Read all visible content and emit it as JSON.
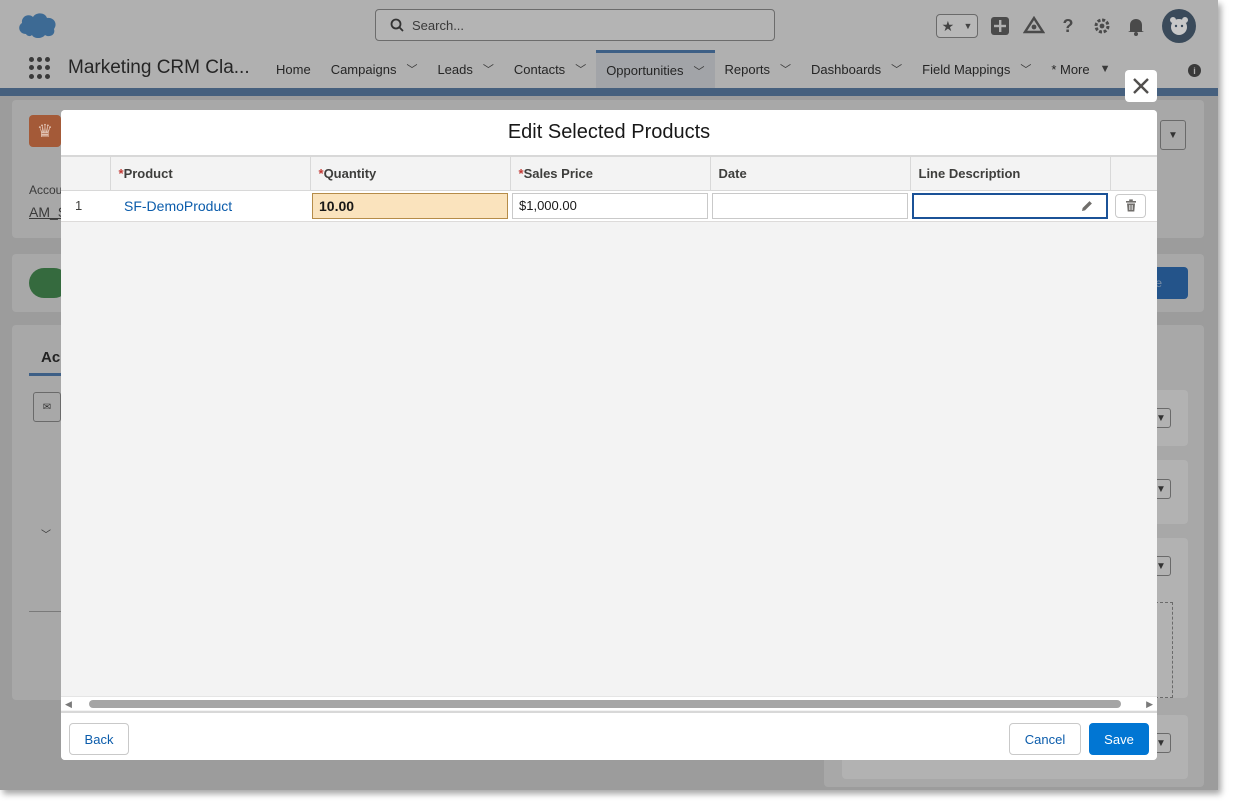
{
  "header": {
    "search_placeholder": "Search...",
    "icons": [
      "salesforce-cloud-logo",
      "search-icon",
      "star-icon",
      "add-icon",
      "trailhead-icon",
      "help-icon",
      "gear-icon",
      "bell-icon",
      "avatar"
    ]
  },
  "nav": {
    "app_name": "Marketing CRM Cla...",
    "items": [
      {
        "label": "Home",
        "has_menu": false
      },
      {
        "label": "Campaigns",
        "has_menu": true
      },
      {
        "label": "Leads",
        "has_menu": true
      },
      {
        "label": "Contacts",
        "has_menu": true
      },
      {
        "label": "Opportunities",
        "has_menu": true,
        "active": true
      },
      {
        "label": "Reports",
        "has_menu": true
      },
      {
        "label": "Dashboards",
        "has_menu": true
      },
      {
        "label": "Field Mappings",
        "has_menu": true
      },
      {
        "label": "* More",
        "has_menu": true
      }
    ]
  },
  "background": {
    "account_label": "Accou",
    "account_value": "AM_S",
    "tab_label": "Ac",
    "blue_button_text": "te"
  },
  "modal": {
    "title": "Edit Selected Products",
    "columns": [
      {
        "label": "Product",
        "required": true
      },
      {
        "label": "Quantity",
        "required": true
      },
      {
        "label": "Sales Price",
        "required": true
      },
      {
        "label": "Date",
        "required": false
      },
      {
        "label": "Line Description",
        "required": false
      }
    ],
    "rows": [
      {
        "num": "1",
        "product": "SF-DemoProduct",
        "quantity": "10.00",
        "sales_price": "$1,000.00",
        "date": "",
        "line_description": ""
      }
    ],
    "footer": {
      "back_label": "Back",
      "cancel_label": "Cancel",
      "save_label": "Save"
    }
  },
  "colors": {
    "brand": "#0176d3",
    "link": "#0b5cab",
    "required": "#c23934",
    "qty_highlight": "#fae3bd",
    "focus_border": "#1b5297"
  }
}
